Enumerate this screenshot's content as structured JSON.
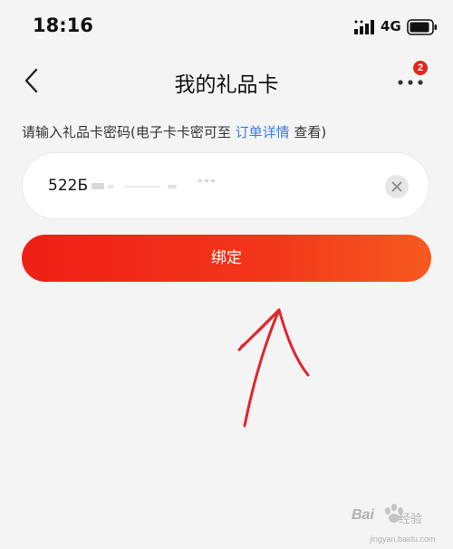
{
  "status_bar": {
    "time": "18:16",
    "network": "4G",
    "signal_icon": "signal-bars-icon",
    "battery_icon": "battery-icon"
  },
  "nav": {
    "title": "我的礼品卡",
    "back_icon": "chevron-left-icon",
    "more_icon": "more-dots-icon",
    "badge_count": "2"
  },
  "instruction": {
    "prefix": "请输入礼品卡密码(电子卡卡密可至 ",
    "link": "订单详情",
    "suffix": " 查看)"
  },
  "code_input": {
    "value": "522Б",
    "clear_icon": "close-icon"
  },
  "bind_button": {
    "label": "绑定"
  },
  "watermark": {
    "brand": "Bai",
    "suffix": "经验",
    "url": "jingyan.baidu.com"
  },
  "colors": {
    "accent_red": "#ef1f15",
    "accent_orange": "#f65a1f",
    "link_blue": "#3b7fe0",
    "badge_red": "#e4261b",
    "background": "#f4f4f4"
  }
}
